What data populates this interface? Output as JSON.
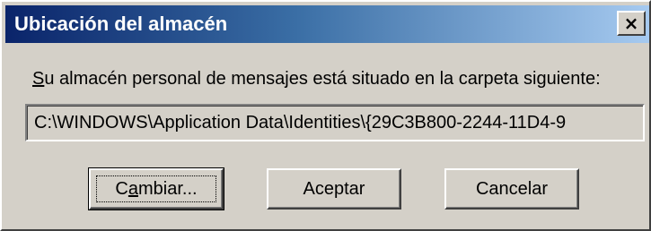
{
  "window": {
    "title": "Ubicación del almacén",
    "close_glyph": "×",
    "close_icon": "close-icon"
  },
  "message": {
    "mnemonic_letter": "S",
    "rest": "u almacén personal de mensajes está situado en la carpeta siguiente:"
  },
  "path_field": {
    "value": "C:\\WINDOWS\\Application Data\\Identities\\{29C3B800-2244-11D4-9"
  },
  "buttons": {
    "change": {
      "pre": "C",
      "mnemonic_letter": "a",
      "post": "mbiar..."
    },
    "accept": {
      "label": "Aceptar"
    },
    "cancel": {
      "label": "Cancelar"
    }
  },
  "colors": {
    "title_gradient_start": "#0a246a",
    "title_gradient_end": "#a6caf0",
    "face": "#d4d0c8"
  }
}
